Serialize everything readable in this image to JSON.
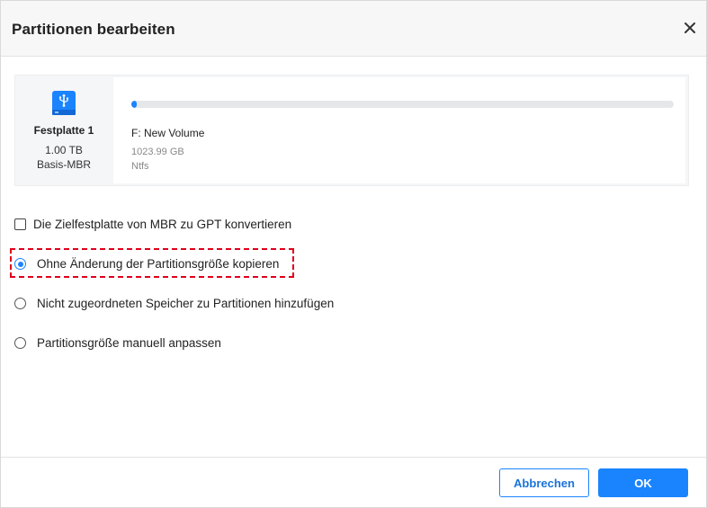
{
  "dialog": {
    "title": "Partitionen bearbeiten",
    "close_icon": "close-icon"
  },
  "disk": {
    "icon": "usb-drive-icon",
    "name": "Festplatte 1",
    "size": "1.00 TB",
    "style": "Basis-MBR"
  },
  "partition": {
    "label": "F: New Volume",
    "size": "1023.99 GB",
    "filesystem": "Ntfs",
    "used_fraction": 0.01
  },
  "options": {
    "convert_checkbox": {
      "label": "Die Zielfestplatte von MBR zu GPT konvertieren",
      "checked": false
    },
    "radios": [
      {
        "label": "Ohne Änderung der Partitionsgröße kopieren",
        "checked": true
      },
      {
        "label": "Nicht zugeordneten Speicher zu Partitionen hinzufügen",
        "checked": false
      },
      {
        "label": "Partitionsgröße manuell anpassen",
        "checked": false
      }
    ]
  },
  "footer": {
    "cancel_label": "Abbrechen",
    "ok_label": "OK"
  },
  "colors": {
    "accent": "#1a84ff",
    "highlight": "#e0001b"
  }
}
